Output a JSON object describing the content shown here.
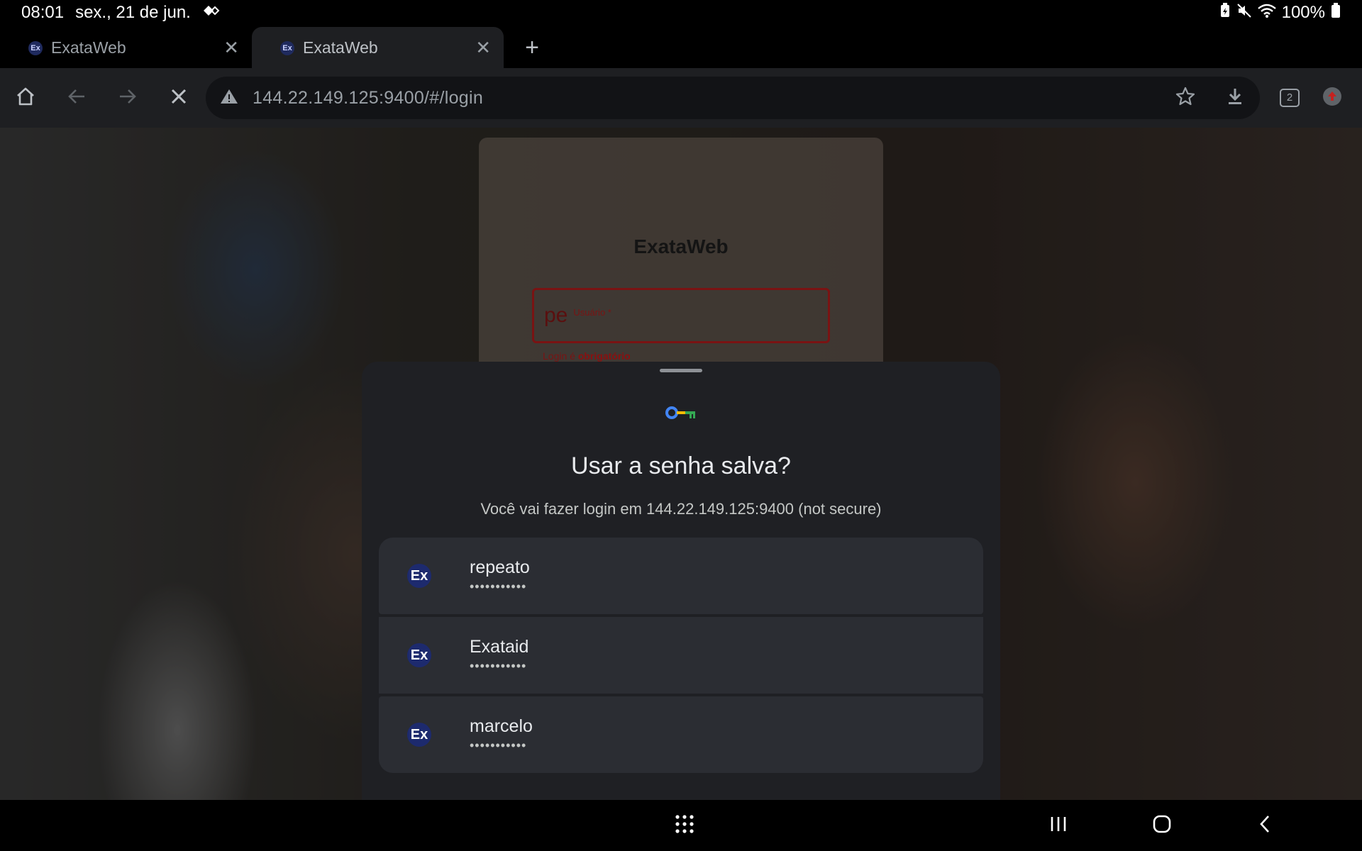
{
  "status_bar": {
    "time": "08:01",
    "date": "sex., 21 de jun.",
    "battery": "100%"
  },
  "tabs": [
    {
      "favicon": "Ex",
      "title": "ExataWeb",
      "active": false
    },
    {
      "favicon": "Ex",
      "title": "ExataWeb",
      "active": true
    }
  ],
  "toolbar": {
    "url": "144.22.149.125:9400/#/login",
    "tab_count": "2"
  },
  "page": {
    "app_title": "ExataWeb",
    "login_value": "pe",
    "login_label": "Usuário *",
    "error_prefix": "Login é",
    "error_emphasis": "obrigatório"
  },
  "sheet": {
    "heading": "Usar a senha salva?",
    "subtitle": "Você vai fazer login em 144.22.149.125:9400 (not secure)",
    "accounts": [
      {
        "icon": "Ex",
        "name": "repeato",
        "password": "•••••••••••"
      },
      {
        "icon": "Ex",
        "name": "Exataid",
        "password": "•••••••••••"
      },
      {
        "icon": "Ex",
        "name": "marcelo",
        "password": "•••••••••••"
      }
    ]
  },
  "icons": {
    "status_left": [
      "gestures-icon"
    ],
    "status_right": [
      "battery-saver-icon",
      "mute-icon",
      "wifi-icon",
      "battery-icon"
    ],
    "toolbar": [
      "home-icon",
      "back-icon",
      "forward-icon",
      "stop-icon",
      "warning-icon",
      "star-icon",
      "download-icon",
      "tab-switcher-icon",
      "profile-icon"
    ],
    "nav": [
      "apps-grid-icon",
      "recents-icon",
      "home-nav-icon",
      "back-nav-icon"
    ]
  },
  "colors": {
    "sheet_bg": "#1f2024",
    "account_bg": "#2b2d33",
    "error_red": "#7a1313",
    "key_blue": "#4285f4",
    "key_yellow": "#fbbc04",
    "key_green": "#34a853"
  }
}
